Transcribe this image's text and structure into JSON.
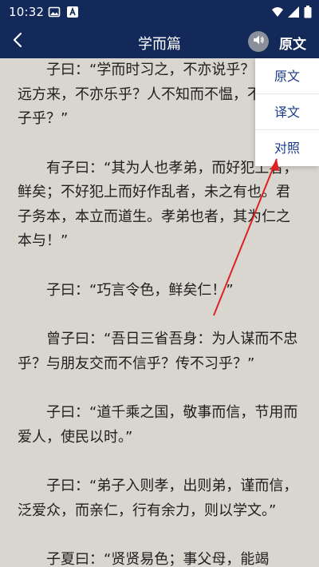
{
  "status_bar": {
    "time": "10:32",
    "icons_left": [
      "image-icon",
      "a-letter-icon"
    ],
    "icons_right": [
      "wifi-icon",
      "signal-icon",
      "battery-icon"
    ]
  },
  "header": {
    "back_icon": "chevron-left-icon",
    "title": "学而篇",
    "audio_icon": "speaker-icon",
    "mode_label": "原文",
    "background_color": "#13295a"
  },
  "dropdown": {
    "items": [
      {
        "label": "原文"
      },
      {
        "label": "译文"
      },
      {
        "label": "对照"
      }
    ],
    "text_color": "#1b3a8a"
  },
  "content": {
    "background_color": "#d9d6cf",
    "paragraphs": [
      "子曰：“学而时习之，不亦说乎？有朋自远方来，不亦乐乎？人不知而不愠，不亦君子乎？”",
      "有子曰：“其为人也孝弟，而好犯上者，鲜矣；不好犯上而好作乱者，未之有也。君子务本，本立而道生。孝弟也者，其为仁之本与！”",
      "子曰：“巧言令色，鲜矣仁！”",
      "曾子曰：“吾日三省吾身：为人谋而不忠乎？与朋友交而不信乎？传不习乎？”",
      "子曰：“道千乘之国，敬事而信，节用而爱人，使民以时。”",
      "子曰：“弟子入则孝，出则弟，谨而信，泛爱众，而亲仁，行有余力，则以学文。”",
      "子夏曰：“贤贤易色；事父母，能竭"
    ]
  },
  "annotation": {
    "arrow_color": "#e02020"
  }
}
